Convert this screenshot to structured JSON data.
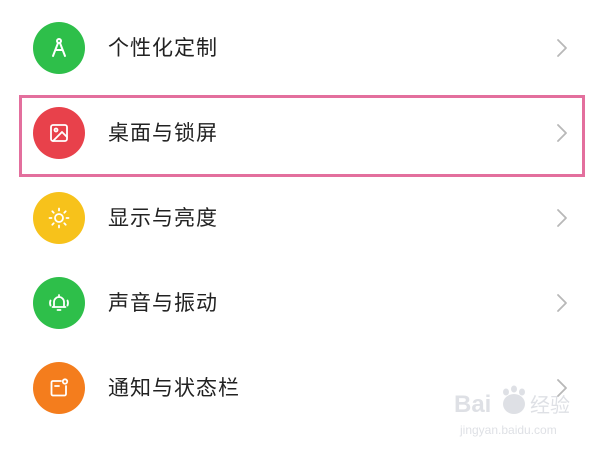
{
  "settings_list": {
    "items": [
      {
        "label": "个性化定制",
        "icon": "compass-icon",
        "icon_color": "#2ebf4a"
      },
      {
        "label": "桌面与锁屏",
        "icon": "image-icon",
        "icon_color": "#e8414b"
      },
      {
        "label": "显示与亮度",
        "icon": "sun-icon",
        "icon_color": "#f7c21b"
      },
      {
        "label": "声音与振动",
        "icon": "bell-vibrate-icon",
        "icon_color": "#2ebf4a"
      },
      {
        "label": "通知与状态栏",
        "icon": "notification-icon",
        "icon_color": "#f47d1d"
      }
    ],
    "chevron_icon": "chevron-right-icon"
  },
  "highlight": {
    "target": "桌面与锁屏",
    "color": "#e36f9d"
  },
  "watermark": {
    "logo": "Baidu 经验",
    "url": "jingyan.baidu.com"
  }
}
